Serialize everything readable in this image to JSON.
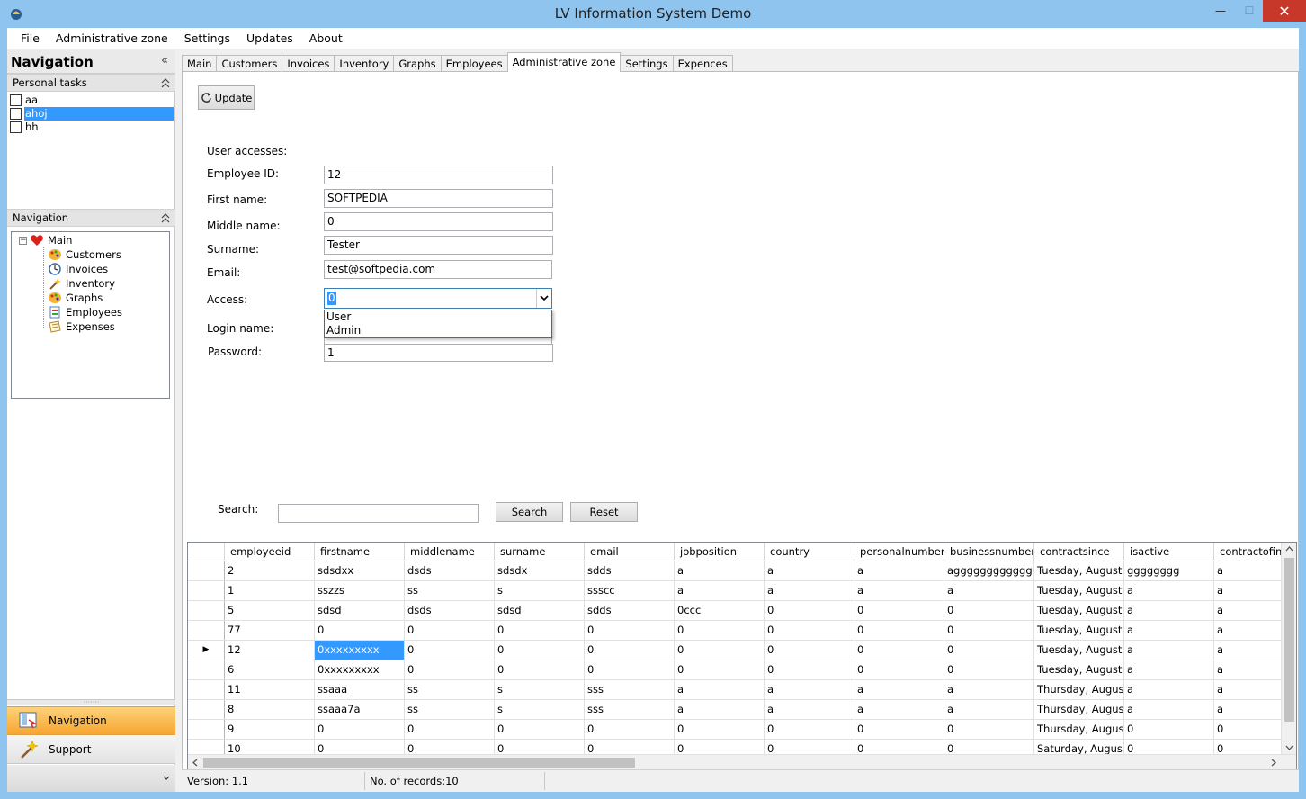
{
  "window": {
    "title": "LV Information System Demo",
    "min": "—",
    "max": "☐",
    "close": "✕"
  },
  "menu": [
    "File",
    "Administrative zone",
    "Settings",
    "Updates",
    "About"
  ],
  "nav": {
    "header": "Navigation",
    "collapse": "«",
    "personal_tasks_title": "Personal tasks",
    "tasks": [
      {
        "label": "aa",
        "checked": false,
        "selected": false
      },
      {
        "label": "ahoj",
        "checked": false,
        "selected": true
      },
      {
        "label": "hh",
        "checked": false,
        "selected": false
      }
    ],
    "navigation_group_title": "Navigation",
    "tree": {
      "root": "Main",
      "children": [
        "Customers",
        "Invoices",
        "Inventory",
        "Graphs",
        "Employees",
        "Expenses"
      ]
    },
    "buttons": {
      "navigation": "Navigation",
      "support": "Support"
    }
  },
  "tabs": [
    "Main",
    "Customers",
    "Invoices",
    "Inventory",
    "Graphs",
    "Employees",
    "Administrative zone",
    "Settings",
    "Expences"
  ],
  "active_tab": "Administrative zone",
  "form": {
    "update_label": "Update",
    "user_accesses_label": "User accesses:",
    "employee_id_label": "Employee ID:",
    "employee_id_value": "12",
    "first_name_label": "First name:",
    "first_name_value": "SOFTPEDIA",
    "middle_name_label": "Middle name:",
    "middle_name_value": "0",
    "surname_label": "Surname:",
    "surname_value": "Tester",
    "email_label": "Email:",
    "email_value": "test@softpedia.com",
    "access_label": "Access:",
    "access_value": "0",
    "access_options": [
      "User",
      "Admin"
    ],
    "login_name_label": "Login name:",
    "password_label": "Password:",
    "password_value": "1"
  },
  "search": {
    "label": "Search:",
    "value": "",
    "search_button": "Search",
    "reset_button": "Reset"
  },
  "grid": {
    "columns": [
      "employeeid",
      "firstname",
      "middlename",
      "surname",
      "email",
      "jobposition",
      "country",
      "personalnumber",
      "businessnumber",
      "contractsince",
      "isactive",
      "contractofinde"
    ],
    "rows": [
      [
        "2",
        "sdsdxx",
        "dsds",
        "sdsdx",
        "sdds",
        "a",
        "a",
        "a",
        "agggggggggggggg",
        "Tuesday, August ...",
        "gggggggg",
        "a"
      ],
      [
        "1",
        "sszzs",
        "ss",
        "s",
        "ssscc",
        "a",
        "a",
        "a",
        "a",
        "Tuesday, August ...",
        "a",
        "a"
      ],
      [
        "5",
        "sdsd",
        "dsds",
        "sdsd",
        "sdds",
        "0ccc",
        "0",
        "0",
        "0",
        "Tuesday, August ...",
        "a",
        "a"
      ],
      [
        "77",
        "0",
        "0",
        "0",
        "0",
        "0",
        "0",
        "0",
        "0",
        "Tuesday, August ...",
        "a",
        "a"
      ],
      [
        "12",
        "0xxxxxxxxx",
        "0",
        "0",
        "0",
        "0",
        "0",
        "0",
        "0",
        "Tuesday, August ...",
        "a",
        "a"
      ],
      [
        "6",
        "0xxxxxxxxx",
        "0",
        "0",
        "0",
        "0",
        "0",
        "0",
        "0",
        "Tuesday, August ...",
        "a",
        "a"
      ],
      [
        "11",
        "ssaaa",
        "ss",
        "s",
        "sss",
        "a",
        "a",
        "a",
        "a",
        "Thursday, August...",
        "a",
        "a"
      ],
      [
        "8",
        "ssaaa7a",
        "ss",
        "s",
        "sss",
        "a",
        "a",
        "a",
        "a",
        "Thursday, August...",
        "a",
        "a"
      ],
      [
        "9",
        "0",
        "0",
        "0",
        "0",
        "0",
        "0",
        "0",
        "0",
        "Thursday, August...",
        "0",
        "0"
      ],
      [
        "10",
        "0",
        "0",
        "0",
        "0",
        "0",
        "0",
        "0",
        "0",
        "Saturday, August...",
        "0",
        "0"
      ]
    ],
    "current_row_marker": "▶"
  },
  "status": {
    "version": "Version: 1.1",
    "records": "No. of records:10"
  },
  "colors": {
    "titlebar": "#8fc4ef",
    "selection": "#3399ff",
    "nav_active": "#f7a52f",
    "close": "#c7382b"
  }
}
